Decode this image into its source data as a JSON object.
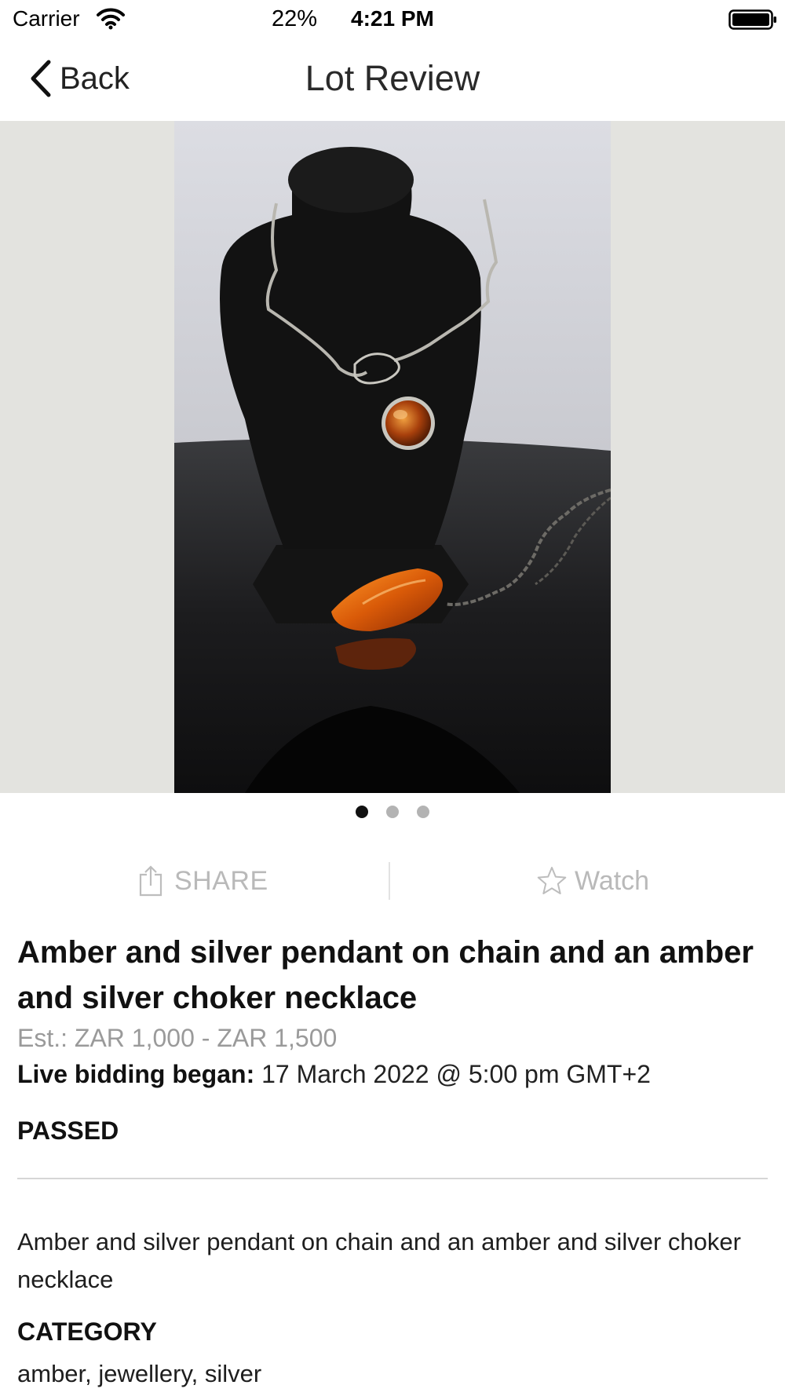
{
  "status_bar": {
    "carrier": "Carrier",
    "battery_percent": "22%",
    "time": "4:21 PM"
  },
  "nav": {
    "back_label": "Back",
    "title": "Lot Review"
  },
  "carousel": {
    "page_count": 3,
    "active_page": 1,
    "photo_description_icon": "necklace-photo"
  },
  "actions": {
    "share_label": "SHARE",
    "watch_label": "Watch"
  },
  "lot": {
    "title": "Amber and silver pendant on chain and an amber and silver choker necklace",
    "estimate": "Est.: ZAR 1,000 - ZAR 1,500",
    "bidding_label": "Live bidding began:",
    "bidding_value": " 17 March 2022 @ 5:00 pm GMT+2",
    "status": "PASSED",
    "description": "Amber and silver pendant on chain and an amber and silver choker necklace",
    "category_heading": "CATEGORY",
    "category_value": "amber, jewellery, silver"
  },
  "colors": {
    "muted_text": "#b9b9b9",
    "estimate_text": "#9a9a9a",
    "photo_background": "#e3e3df"
  }
}
